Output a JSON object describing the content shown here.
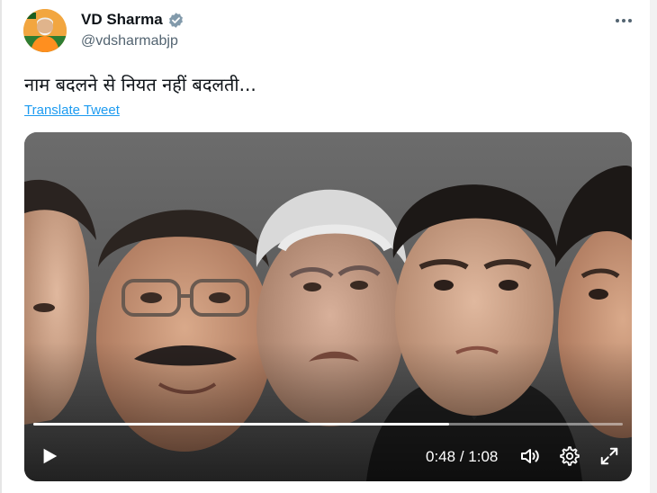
{
  "tweet": {
    "author_name": "VD Sharma",
    "author_handle": "@vdsharmabjp",
    "text": "नाम बदलने से नियत नहीं बदलती...",
    "translate_label": "Translate Tweet",
    "avatar_icon": "profile-avatar",
    "verified_icon": "verified-badge-icon",
    "more_icon": "more-dots-icon"
  },
  "video": {
    "elapsed": "0:48",
    "separator": " / ",
    "duration": "1:08",
    "progress_fraction": 0.706,
    "icons": {
      "play": "play-icon",
      "volume": "volume-icon",
      "settings": "gear-icon",
      "fullscreen": "expand-icon"
    }
  },
  "colors": {
    "link": "#1d9bf0",
    "text": "#0f1419",
    "secondary": "#536471",
    "verified": "#829aab"
  }
}
